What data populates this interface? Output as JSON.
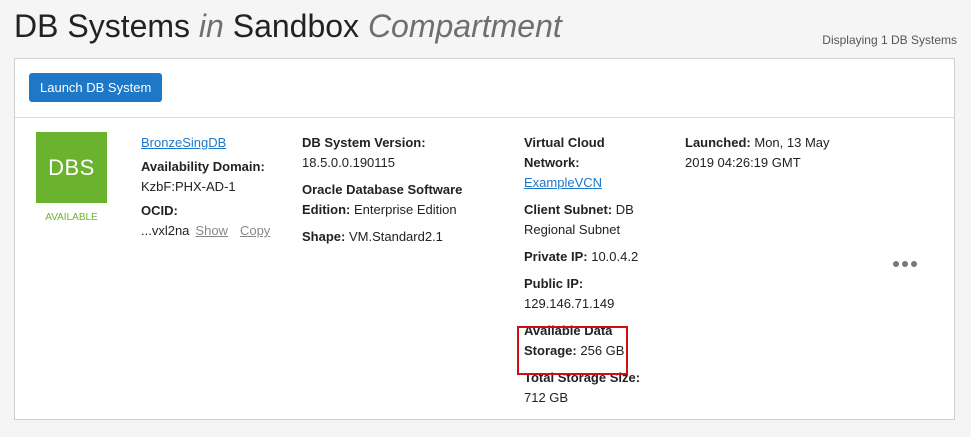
{
  "header": {
    "title_part1": "DB Systems",
    "title_in": "in",
    "title_part2": "Sandbox",
    "title_compartment": "Compartment",
    "count_text": "Displaying 1 DB Systems"
  },
  "toolbar": {
    "launch_label": "Launch DB System"
  },
  "db_system": {
    "icon_text": "DBS",
    "status": "AVAILABLE",
    "name": "BronzeSingDB",
    "availability_domain_label": "Availability Domain:",
    "availability_domain": "KzbF:PHX-AD-1",
    "ocid_label": "OCID:",
    "ocid": "...vxl2na",
    "show_label": "Show",
    "copy_label": "Copy",
    "version_label": "DB System Version:",
    "version": "18.5.0.0.190115",
    "edition_label_1": "Oracle Database Software",
    "edition_label_2": "Edition:",
    "edition": "Enterprise Edition",
    "shape_label": "Shape:",
    "shape": "VM.Standard2.1",
    "vcn_label_1": "Virtual Cloud",
    "vcn_label_2": "Network:",
    "vcn": "ExampleVCN",
    "subnet_label": "Client Subnet:",
    "subnet_1": "DB",
    "subnet_2": "Regional Subnet",
    "private_ip_label": "Private IP:",
    "private_ip": "10.0.4.2",
    "public_ip_label": "Public IP:",
    "public_ip": "129.146.71.149",
    "storage_label_1": "Available Data",
    "storage_label_2": "Storage:",
    "storage": "256 GB",
    "total_storage_label": "Total Storage Size:",
    "total_storage": "712 GB",
    "launched_label": "Launched:",
    "launched_1": "Mon, 13 May",
    "launched_2": "2019 04:26:19 GMT"
  },
  "colors": {
    "accent": "#1d78c8",
    "available": "#6bb32e",
    "highlight": "#d01010"
  },
  "icons": {
    "actions": "more-horizontal-icon"
  }
}
